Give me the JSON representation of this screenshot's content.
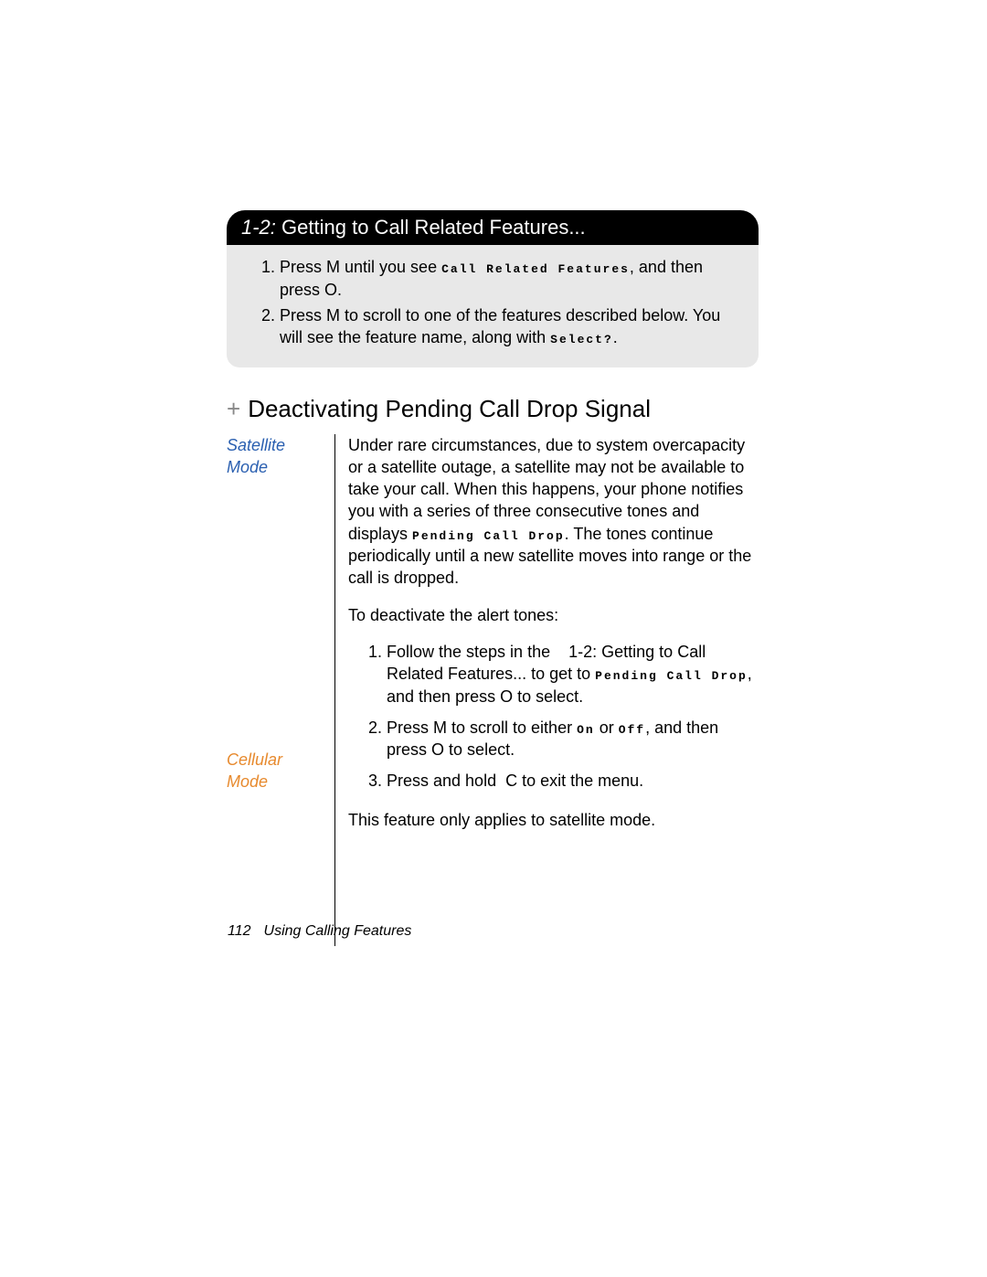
{
  "blackbox": {
    "prefix": "1-2:",
    "title": "Getting to Call Related Features..."
  },
  "graysteps": {
    "s1a": "Press ",
    "s1key1": "M",
    "s1b": " until you see ",
    "s1disp": "Call Related Features",
    "s1c": ", and then press ",
    "s1key2": "O",
    "s1d": ".",
    "s2a": "Press ",
    "s2key1": "M",
    "s2b": " to scroll to one of the features described below. You will see the feature name, along with ",
    "s2disp": "Select?",
    "s2c": "."
  },
  "heading": {
    "plus": "+",
    "title": "Deactivating Pending Call Drop Signal"
  },
  "satellite": {
    "label": "Satellite Mode",
    "p1a": "Under rare circumstances, due to system overcapacity or a satellite outage, a satellite may not be available to take your call. When this happens, your phone notifies you with a series of three consecutive tones and displays ",
    "p1disp": "Pending Call Drop",
    "p1b": ". The tones continue periodically until a new satellite moves into range or the call is dropped.",
    "p2": "To deactivate the alert tones:",
    "li1a": "Follow the steps in the ",
    "li1ref": "1-2: Getting to Call Related Features...",
    "li1b": " to get to ",
    "li1disp": "Pending Call Drop",
    "li1c": ", and then press ",
    "li1key": "O",
    "li1d": " to select.",
    "li2a": "Press ",
    "li2key1": "M",
    "li2b": " to scroll to either ",
    "li2dispOn": "On",
    "li2or": " or ",
    "li2dispOff": "Off",
    "li2c": ", and then press ",
    "li2key2": "O",
    "li2d": " to select.",
    "li3a": "Press and hold ",
    "li3key": "C",
    "li3b": " to exit the menu."
  },
  "cellular": {
    "label": "Cellular Mode",
    "p1": "This feature only applies to satellite mode."
  },
  "footer": {
    "page": "112",
    "title": "Using Calling Features"
  }
}
